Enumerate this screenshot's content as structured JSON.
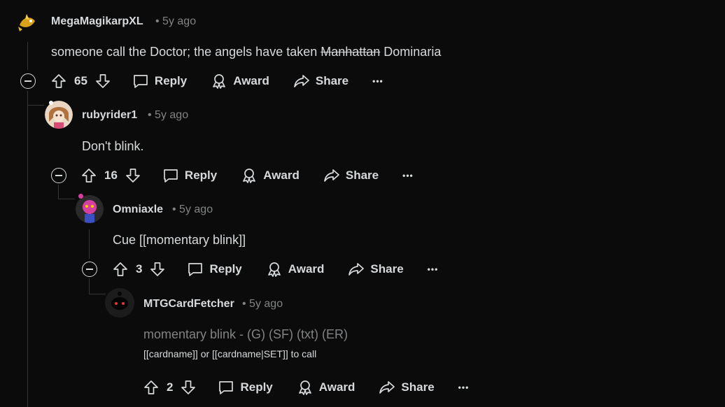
{
  "comments": [
    {
      "username": "MegaMagikarpXL",
      "age": "• 5y ago",
      "text_before": "someone call the Doctor; the angels have taken ",
      "text_struck": "Manhattan",
      "text_after": " Dominaria",
      "score": "65",
      "reply_label": "Reply",
      "award_label": "Award",
      "share_label": "Share",
      "more_label": "•••"
    },
    {
      "username": "rubyrider1",
      "age": "• 5y ago",
      "text": "Don't blink.",
      "score": "16",
      "reply_label": "Reply",
      "award_label": "Award",
      "share_label": "Share",
      "more_label": "•••"
    },
    {
      "username": "Omniaxle",
      "age": "• 5y ago",
      "text": "Cue [[momentary blink]]",
      "score": "3",
      "reply_label": "Reply",
      "award_label": "Award",
      "share_label": "Share",
      "more_label": "•••"
    },
    {
      "username": "MTGCardFetcher",
      "age": "• 5y ago",
      "text": "momentary blink - (G) (SF) (txt) (ER)",
      "subtext": "[[cardname]] or [[cardname|SET]] to call",
      "score": "2",
      "reply_label": "Reply",
      "award_label": "Award",
      "share_label": "Share",
      "more_label": "•••"
    }
  ],
  "colors": {
    "background": "#0b0b0b",
    "text": "#d7dadc",
    "muted": "#818384",
    "thread_line": "#343536"
  }
}
